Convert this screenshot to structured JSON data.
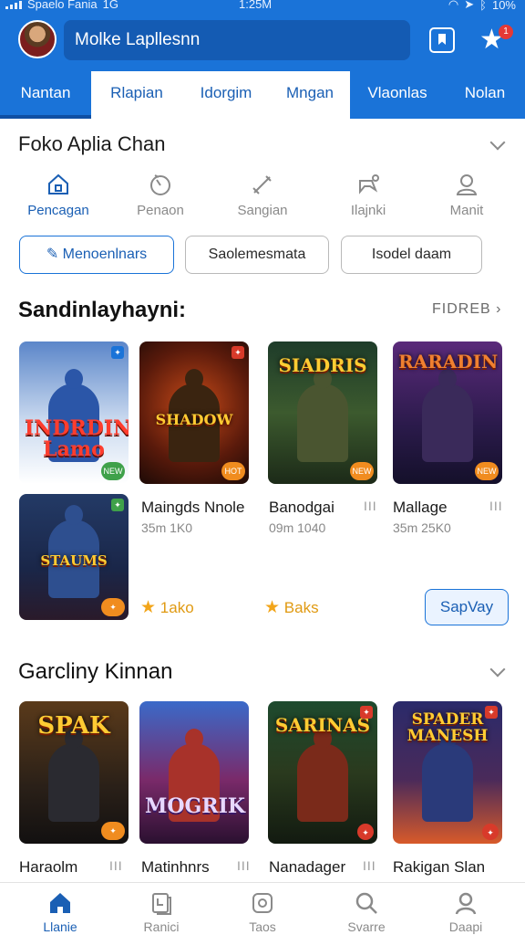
{
  "status": {
    "carrier": "Spaelo Fania",
    "network": "1G",
    "time": "1:25M",
    "battery": "10%"
  },
  "header": {
    "search_text": "Molke Lapllesnn",
    "notification_count": "1"
  },
  "tabs": [
    {
      "label": "Nantan"
    },
    {
      "label": "Rlapian"
    },
    {
      "label": "Idorgim"
    },
    {
      "label": "Mngan"
    },
    {
      "label": "Vlaonlas"
    },
    {
      "label": "Nolan"
    }
  ],
  "section1": {
    "title": "Foko Aplia Chan",
    "categories": [
      {
        "label": "Pencagan",
        "icon": "home-icon"
      },
      {
        "label": "Penaon",
        "icon": "timer-icon"
      },
      {
        "label": "Sangian",
        "icon": "sword-icon"
      },
      {
        "label": "Ilajnki",
        "icon": "controller-icon"
      },
      {
        "label": "Manit",
        "icon": "person-icon"
      }
    ],
    "chips": [
      {
        "label": "Menoenlnars"
      },
      {
        "label": "Saolemesmata"
      },
      {
        "label": "Isodel daam"
      }
    ]
  },
  "section2": {
    "title": "Sandinlayhayni:",
    "see_all": "FIDREB",
    "games_row1": [
      {
        "art": "INDRDIN Lamo",
        "badge": "NEW"
      },
      {
        "art": "SHADOW",
        "badge": "HOT"
      },
      {
        "art": "SIADRIS",
        "badge": "NEW"
      },
      {
        "art": "RARADIN",
        "badge": "NEW"
      }
    ],
    "game_row2_art": "STAUMS",
    "games_list": [
      {
        "name": "Maingds Nnole",
        "meta": "35m 1K0",
        "rating": "1ako"
      },
      {
        "name": "Banodgai",
        "meta": "09m 1040",
        "rating": "Baks"
      },
      {
        "name": "Mallage",
        "meta": "35m 25K0"
      }
    ],
    "save_button": "SapVay"
  },
  "section3": {
    "title": "Garcliny Kinnan",
    "games": [
      {
        "art": "SPAK",
        "name": "Haraolm"
      },
      {
        "art": "MOGRIK",
        "name": "Matinhnrs"
      },
      {
        "art": "SARINAS",
        "name": "Nanadager"
      },
      {
        "art": "SPADER MANESH",
        "name": "Rakigan Slan"
      }
    ]
  },
  "bottom_nav": [
    {
      "label": "Llanie",
      "icon": "home-icon"
    },
    {
      "label": "Ranici",
      "icon": "library-icon"
    },
    {
      "label": "Taos",
      "icon": "tasks-icon"
    },
    {
      "label": "Svarre",
      "icon": "search-icon"
    },
    {
      "label": "Daapi",
      "icon": "profile-icon"
    }
  ],
  "colors": {
    "primary": "#1a73d8",
    "header_dark": "#145bb3",
    "accent_orange": "#f08c1f",
    "rating": "#f2a51a"
  }
}
